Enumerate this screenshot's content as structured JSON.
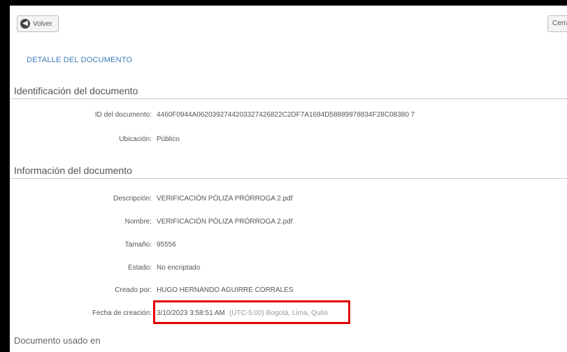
{
  "toolbar": {
    "back_label": "Volver",
    "right_label": "Cerrar"
  },
  "page_title": "DETALLE DEL DOCUMENTO",
  "sections": {
    "identification": {
      "title": "Identificación del documento",
      "fields": [
        {
          "label": "ID del documento:",
          "value": "4460F0944A0620392744203327426822C2DF7A1684D58889978834F28C08380 7"
        },
        {
          "label": "Ubicación:",
          "value": "Público"
        }
      ]
    },
    "information": {
      "title": "Información del documento",
      "fields": [
        {
          "label": "Descripción:",
          "value": "VERIFICACIÓN PÓLIZA PRÓRROGA 2.pdf"
        },
        {
          "label": "Nombre:",
          "value": "VERIFICACIÓN PÓLIZA PRÓRROGA 2.pdf"
        },
        {
          "label": "Tamaño:",
          "value": "95556"
        },
        {
          "label": "Estado:",
          "value": "No encriptado"
        },
        {
          "label": "Creado por:",
          "value": "HUGO HERNANDO AGUIRRE CORRALES"
        },
        {
          "label": "Fecha de creación:",
          "value": "3/10/2023 3:58:51 AM",
          "hint": "(UTC-5:00) Bogotá, Lima, Quito"
        }
      ]
    }
  },
  "bottom_section_title": "Documento usado en"
}
